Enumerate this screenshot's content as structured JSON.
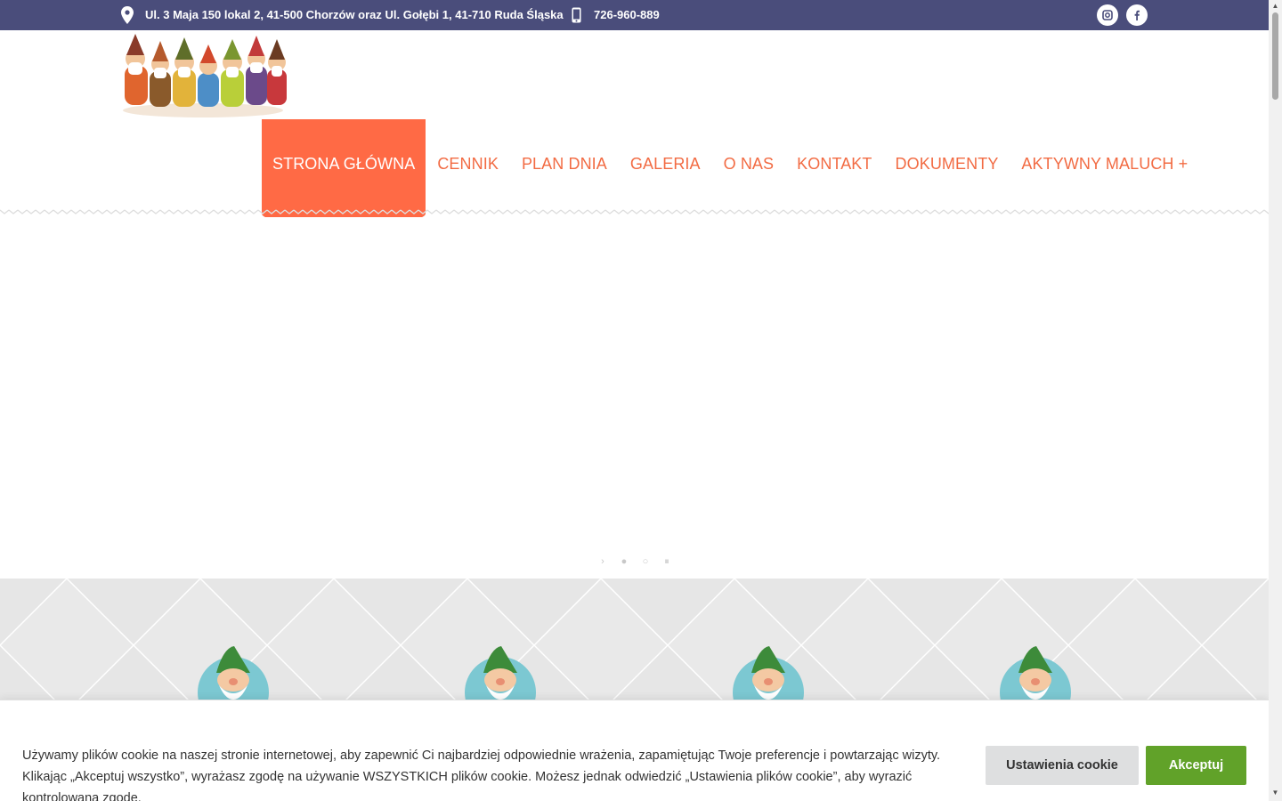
{
  "topbar": {
    "address": "Ul. 3 Maja 150 lokal 2, 41-500 Chorzów oraz Ul. Gołębi 1, 41-710 Ruda Śląska",
    "phone": "726-960-889",
    "address_icon": "map-pin-icon",
    "phone_icon": "mobile-phone-icon",
    "social": [
      "instagram-icon",
      "facebook-icon"
    ]
  },
  "logo": {
    "icon": "seven-dwarfs-logo"
  },
  "nav": {
    "items": [
      {
        "label": "STRONA GŁÓWNA",
        "active": true
      },
      {
        "label": "CENNIK"
      },
      {
        "label": "PLAN DNIA"
      },
      {
        "label": "GALERIA"
      },
      {
        "label": "O NAS"
      },
      {
        "label": "KONTAKT"
      },
      {
        "label": "DOKUMENTY"
      },
      {
        "label": "AKTYWNY MALUCH +"
      }
    ]
  },
  "slider": {
    "controls": [
      "›",
      "●",
      "○",
      "⏸"
    ]
  },
  "features": {
    "icons": [
      "gnome-icon",
      "gnome-icon",
      "gnome-icon",
      "gnome-icon"
    ]
  },
  "cookie": {
    "text": "Używamy plików cookie na naszej stronie internetowej, aby zapewnić Ci najbardziej odpowiednie wrażenia, zapamiętując Twoje preferencje i powtarzając wizyty. Klikając „Akceptuj wszystko”, wyrażasz zgodę na używanie WSZYSTKICH plików cookie. Możesz jednak odwiedzić „Ustawienia plików cookie”, aby wyrazić kontrolowaną zgodę.",
    "settings_label": "Ustawienia cookie",
    "accept_label": "Akceptuj"
  },
  "colors": {
    "topbar": "#4a4d7b",
    "accent": "#ff6a45",
    "nav_text": "#f26b43",
    "accept": "#61a229"
  }
}
